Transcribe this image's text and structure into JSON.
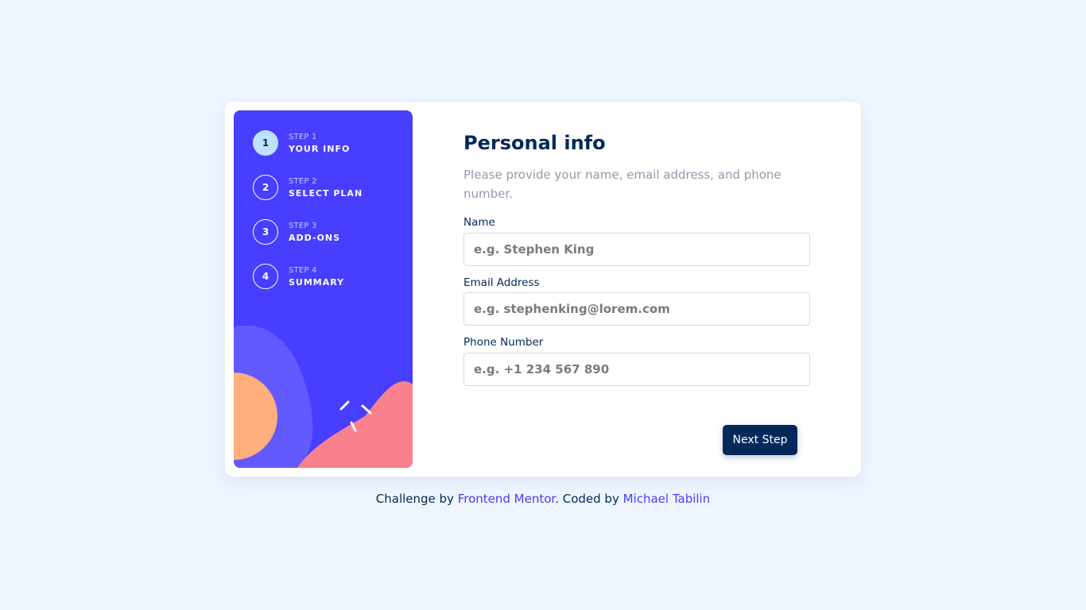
{
  "sidebar": {
    "steps": [
      {
        "number": "1",
        "label": "STEP 1",
        "title": "YOUR INFO",
        "active": true
      },
      {
        "number": "2",
        "label": "STEP 2",
        "title": "SELECT PLAN",
        "active": false
      },
      {
        "number": "3",
        "label": "STEP 3",
        "title": "ADD-ONS",
        "active": false
      },
      {
        "number": "4",
        "label": "STEP 4",
        "title": "SUMMARY",
        "active": false
      }
    ]
  },
  "form": {
    "title": "Personal info",
    "subtitle": "Please provide your name, email address, and phone number.",
    "fields": [
      {
        "label": "Name",
        "placeholder": "e.g. Stephen King",
        "value": ""
      },
      {
        "label": "Email Address",
        "placeholder": "e.g. stephenking@lorem.com",
        "value": ""
      },
      {
        "label": "Phone Number",
        "placeholder": "e.g. +1 234 567 890",
        "value": ""
      }
    ],
    "next_label": "Next Step"
  },
  "footer": {
    "prefix": "Challenge by ",
    "link1": "Frontend Mentor",
    "middle": ". Coded by ",
    "link2": "Michael Tabilin"
  },
  "colors": {
    "sidebar_bg": "#483eff",
    "active_step": "#bee2fd",
    "primary_text": "#02295a",
    "muted_text": "#9699ab",
    "page_bg": "#eef5ff",
    "link": "#483eff"
  }
}
